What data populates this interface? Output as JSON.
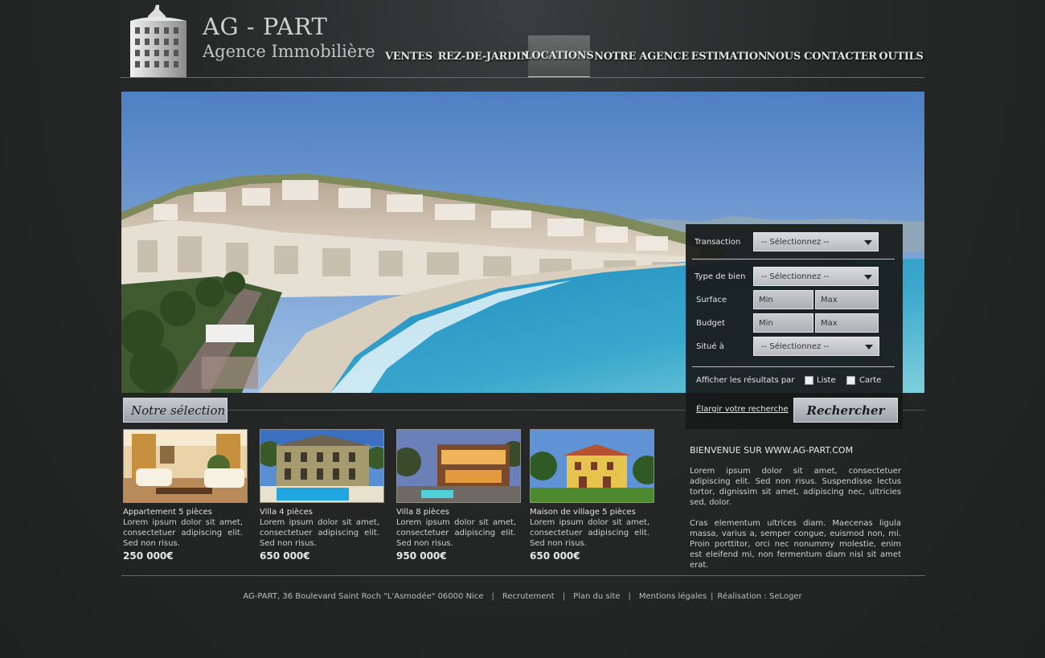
{
  "header": {
    "logo_title": "AG - PART",
    "logo_subtitle": "Agence Immobilière",
    "nav": [
      {
        "label": "VENTES",
        "active": false
      },
      {
        "label": "REZ-DE-JARDIN",
        "active": false
      },
      {
        "label": "LOCATIONS",
        "active": true
      },
      {
        "label": "NOTRE AGENCE",
        "active": false
      },
      {
        "label": "ESTIMATION",
        "active": false
      },
      {
        "label": "NOUS CONTACTER",
        "active": false
      },
      {
        "label": "OUTILS",
        "active": false
      }
    ]
  },
  "search": {
    "transaction_label": "Transaction",
    "transaction_value": "-- Sélectionnez --",
    "type_label": "Type de bien",
    "type_value": "-- Sélectionnez --",
    "surface_label": "Surface",
    "surface_min_placeholder": "Min",
    "surface_max_placeholder": "Max",
    "budget_label": "Budget",
    "budget_min_placeholder": "Min",
    "budget_max_placeholder": "Max",
    "location_label": "Situé à",
    "location_value": "-- Sélectionnez --",
    "display_label": "Afficher les résultats par",
    "option_list": "Liste",
    "option_map": "Carte",
    "expand_link": "Élargir votre recherche",
    "submit_label": "Rechercher"
  },
  "selection": {
    "heading": "Notre sélection",
    "items": [
      {
        "title": "Appartement 5 pièces",
        "desc": "Lorem ipsum dolor sit amet, consectetuer adipiscing elit. Sed non risus.",
        "price": "250 000€"
      },
      {
        "title": "Villa 4 pièces",
        "desc": "Lorem ipsum dolor sit amet, consectetuer adipiscing elit. Sed non risus.",
        "price": "650 000€"
      },
      {
        "title": "Villa 8 pièces",
        "desc": "Lorem ipsum dolor sit amet, consectetuer adipiscing elit. Sed non risus.",
        "price": "950 000€"
      },
      {
        "title": "Maison de village 5 pièces",
        "desc": "Lorem ipsum dolor sit amet, consectetuer adipiscing elit. Sed non risus.",
        "price": "650 000€"
      }
    ]
  },
  "welcome": {
    "title": "BIENVENUE SUR WWW.AG-PART.COM",
    "paragraph1": "Lorem ipsum dolor sit amet, consectetuer adipiscing elit. Sed non risus. Suspendisse lectus tortor, dignissim sit amet, adipiscing nec, ultricies sed, dolor.",
    "paragraph2": "Cras elementum ultrices diam. Maecenas ligula massa, varius a, semper congue, euismod non, mi. Proin porttitor, orci nec nonummy molestie, enim est eleifend mi, non fermentum diam nisl sit amet erat."
  },
  "footer": {
    "address": "AG-PART, 36 Boulevard Saint Roch \"L'Asmodée\" 06000 Nice",
    "recruitment": "Recrutement",
    "sitemap": "Plan du site",
    "legal": "Mentions légales",
    "credit": "Réalisation : SeLoger"
  },
  "colors": {
    "background": "#262828",
    "panel": "#1a1c1c",
    "button": "#b3b8be",
    "sea": "#2f9fc0",
    "sky": "#5b8ac7"
  }
}
